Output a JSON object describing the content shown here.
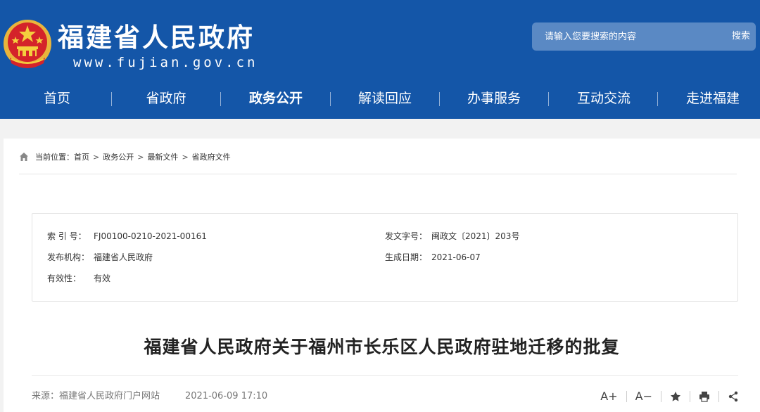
{
  "header": {
    "site_title": "福建省人民政府",
    "site_url": "www.fujian.gov.cn",
    "search": {
      "placeholder": "请输入您要搜索的内容",
      "button": "搜索"
    },
    "nav": [
      {
        "label": "首页",
        "active": false
      },
      {
        "label": "省政府",
        "active": false
      },
      {
        "label": "政务公开",
        "active": true
      },
      {
        "label": "解读回应",
        "active": false
      },
      {
        "label": "办事服务",
        "active": false
      },
      {
        "label": "互动交流",
        "active": false
      },
      {
        "label": "走进福建",
        "active": false
      }
    ],
    "color": "#1456a8"
  },
  "breadcrumb": {
    "prefix": "当前位置：",
    "items": [
      "首页",
      "政务公开",
      "最新文件",
      "省政府文件"
    ],
    "separator": ">"
  },
  "info": {
    "index_label": "索 引 号：",
    "index_value": "FJ00100-0210-2021-00161",
    "doc_no_label": "发文字号：",
    "doc_no_value": "闽政文〔2021〕203号",
    "issuer_label": "发布机构：",
    "issuer_value": "福建省人民政府",
    "date_label": "生成日期：",
    "date_value": "2021-06-07",
    "validity_label": "有效性：",
    "validity_value": "有效"
  },
  "article": {
    "title": "福建省人民政府关于福州市长乐区人民政府驻地迁移的批复",
    "source": "来源：福建省人民政府门户网站",
    "published": "2021-06-09 17:10"
  },
  "tools": {
    "font_increase": "A+",
    "font_decrease": "A−"
  }
}
